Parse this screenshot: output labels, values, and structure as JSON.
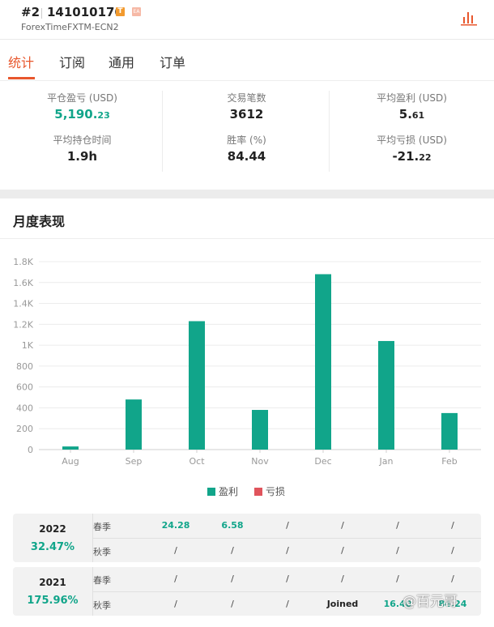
{
  "header": {
    "rank": "#2",
    "account": "141010170",
    "badge_t": "T",
    "badge_ea": "EA",
    "broker": "ForexTimeFXTM-ECN2",
    "chart_icon": "bar-chart-icon"
  },
  "tabs": [
    {
      "label": "统计",
      "active": true
    },
    {
      "label": "订阅",
      "active": false
    },
    {
      "label": "通用",
      "active": false
    },
    {
      "label": "订单",
      "active": false
    }
  ],
  "stats": {
    "pnl": {
      "label": "平仓盈亏 (USD)",
      "int": "5,190.",
      "dec": "23"
    },
    "trades": {
      "label": "交易笔数",
      "value": "3612"
    },
    "avg_profit": {
      "label": "平均盈利 (USD)",
      "int": "5.",
      "dec": "61"
    },
    "hold_time": {
      "label": "平均持仓时间",
      "value": "1.9h"
    },
    "win_rate": {
      "label": "胜率 (%)",
      "value": "84.44"
    },
    "avg_loss": {
      "label": "平均亏损 (USD)",
      "int": "-21.",
      "dec": "22"
    }
  },
  "monthly": {
    "title": "月度表现",
    "legend": [
      {
        "label": "盈利",
        "color": "#11a58a"
      },
      {
        "label": "亏损",
        "color": "#e0545c"
      }
    ]
  },
  "chart_data": {
    "type": "bar",
    "categories": [
      "Aug",
      "Sep",
      "Oct",
      "Nov",
      "Dec",
      "Jan",
      "Feb"
    ],
    "series": [
      {
        "name": "盈利",
        "color": "#11a58a",
        "values": [
          30,
          480,
          1230,
          380,
          1680,
          1040,
          350
        ]
      }
    ],
    "ylim": [
      0,
      1800
    ],
    "yticks": [
      "0",
      "200",
      "400",
      "600",
      "800",
      "1K",
      "1.2K",
      "1.4K",
      "1.6K",
      "1.8K"
    ],
    "grid": true,
    "legend": "bottom-center"
  },
  "yearly": [
    {
      "year": "2022",
      "pct": "32.47%",
      "rows": [
        {
          "season": "春季",
          "cells": [
            "24.28",
            "6.58",
            "/",
            "/",
            "/",
            "/"
          ]
        },
        {
          "season": "秋季",
          "cells": [
            "/",
            "/",
            "/",
            "/",
            "/",
            "/"
          ]
        }
      ]
    },
    {
      "year": "2021",
      "pct": "175.96%",
      "rows": [
        {
          "season": "春季",
          "cells": [
            "/",
            "/",
            "/",
            "/",
            "/",
            "/"
          ]
        },
        {
          "season": "秋季",
          "cells": [
            "/",
            "/",
            "/",
            "Joined",
            "16.40",
            "84.24"
          ]
        }
      ]
    }
  ],
  "watermark": "@百元哥"
}
